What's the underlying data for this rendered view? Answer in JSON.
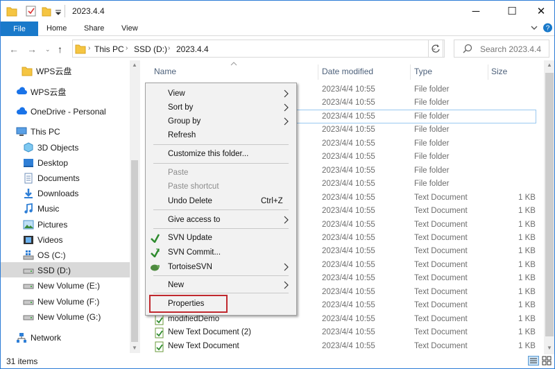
{
  "window": {
    "title": "2023.4.4",
    "controls": {
      "minimize": "─",
      "maximize": "☐",
      "close": "✕"
    }
  },
  "ribbon": {
    "tabs": [
      "File",
      "Home",
      "Share",
      "View"
    ],
    "expand_icon": "chevron-down-icon",
    "help_icon": "help-icon"
  },
  "address": {
    "breadcrumb": [
      "This PC",
      "SSD (D:)",
      "2023.4.4"
    ],
    "search_placeholder": "Search 2023.4.4"
  },
  "nav": {
    "items": [
      {
        "label": "WPS云盘",
        "icon": "folder-icon"
      },
      {
        "label": "WPS云盘",
        "icon": "cloud-icon"
      },
      {
        "label": "OneDrive - Personal",
        "icon": "cloud-icon"
      },
      {
        "label": "This PC",
        "icon": "computer-icon"
      },
      {
        "label": "3D Objects",
        "icon": "cube-icon"
      },
      {
        "label": "Desktop",
        "icon": "desktop-icon"
      },
      {
        "label": "Documents",
        "icon": "documents-icon"
      },
      {
        "label": "Downloads",
        "icon": "download-icon"
      },
      {
        "label": "Music",
        "icon": "music-icon"
      },
      {
        "label": "Pictures",
        "icon": "pictures-icon"
      },
      {
        "label": "Videos",
        "icon": "videos-icon"
      },
      {
        "label": "OS (C:)",
        "icon": "windows-drive-icon"
      },
      {
        "label": "SSD (D:)",
        "icon": "drive-icon"
      },
      {
        "label": "New Volume (E:)",
        "icon": "drive-icon"
      },
      {
        "label": "New Volume (F:)",
        "icon": "drive-icon"
      },
      {
        "label": "New Volume (G:)",
        "icon": "drive-icon"
      },
      {
        "label": "Network",
        "icon": "network-icon"
      }
    ]
  },
  "list": {
    "columns": [
      "Name",
      "Date modified",
      "Type",
      "Size"
    ],
    "rows": [
      {
        "name": "",
        "date": "2023/4/4 10:55",
        "type": "File folder",
        "size": ""
      },
      {
        "name": "",
        "date": "2023/4/4 10:55",
        "type": "File folder",
        "size": ""
      },
      {
        "name": "",
        "date": "2023/4/4 10:55",
        "type": "File folder",
        "size": ""
      },
      {
        "name": "",
        "date": "2023/4/4 10:55",
        "type": "File folder",
        "size": ""
      },
      {
        "name": "",
        "date": "2023/4/4 10:55",
        "type": "File folder",
        "size": ""
      },
      {
        "name": "",
        "date": "2023/4/4 10:55",
        "type": "File folder",
        "size": ""
      },
      {
        "name": "",
        "date": "2023/4/4 10:55",
        "type": "File folder",
        "size": ""
      },
      {
        "name": "",
        "date": "2023/4/4 10:55",
        "type": "File folder",
        "size": ""
      },
      {
        "name": "",
        "date": "2023/4/4 10:55",
        "type": "Text Document",
        "size": "1 KB"
      },
      {
        "name": "",
        "date": "2023/4/4 10:55",
        "type": "Text Document",
        "size": "1 KB"
      },
      {
        "name": "",
        "date": "2023/4/4 10:55",
        "type": "Text Document",
        "size": "1 KB"
      },
      {
        "name": "",
        "date": "2023/4/4 10:55",
        "type": "Text Document",
        "size": "1 KB"
      },
      {
        "name": "",
        "date": "2023/4/4 10:55",
        "type": "Text Document",
        "size": "1 KB"
      },
      {
        "name": "",
        "date": "2023/4/4 10:55",
        "type": "Text Document",
        "size": "1 KB"
      },
      {
        "name": "",
        "date": "2023/4/4 10:55",
        "type": "Text Document",
        "size": "1 KB"
      },
      {
        "name": "",
        "date": "2023/4/4 10:55",
        "type": "Text Document",
        "size": "1 KB"
      },
      {
        "name": "",
        "date": "2023/4/4 10:55",
        "type": "Text Document",
        "size": "1 KB"
      },
      {
        "name": "modifiedDemo",
        "date": "2023/4/4 10:55",
        "type": "Text Document",
        "size": "1 KB"
      },
      {
        "name": "New Text Document (2)",
        "date": "2023/4/4 10:55",
        "type": "Text Document",
        "size": "1 KB"
      },
      {
        "name": "New Text Document",
        "date": "2023/4/4 10:55",
        "type": "Text Document",
        "size": "1 KB"
      }
    ],
    "status": "31 items"
  },
  "context_menu": {
    "items": [
      {
        "label": "View",
        "submenu": true
      },
      {
        "label": "Sort by",
        "submenu": true
      },
      {
        "label": "Group by",
        "submenu": true
      },
      {
        "label": "Refresh"
      },
      {
        "label": "Customize this folder..."
      },
      {
        "label": "Paste",
        "disabled": true
      },
      {
        "label": "Paste shortcut",
        "disabled": true
      },
      {
        "label": "Undo Delete",
        "shortcut": "Ctrl+Z"
      },
      {
        "label": "Give access to",
        "submenu": true
      },
      {
        "label": "SVN Update",
        "icon": "svn-update-icon"
      },
      {
        "label": "SVN Commit...",
        "icon": "svn-commit-icon"
      },
      {
        "label": "TortoiseSVN",
        "icon": "tortoisesvn-icon",
        "submenu": true
      },
      {
        "label": "New",
        "submenu": true
      },
      {
        "label": "Properties",
        "highlighted": true
      }
    ]
  },
  "colors": {
    "accent": "#1979ca",
    "highlight": "#c0282e",
    "folder": "#f5c542"
  }
}
